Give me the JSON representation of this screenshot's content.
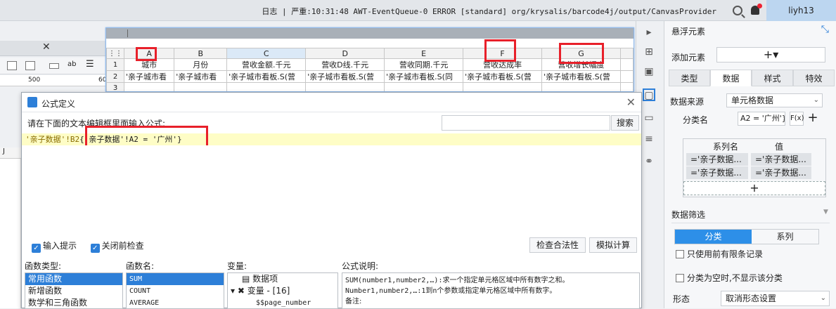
{
  "topbar": {
    "status_text": "日志 | 严重:10:31:48 AWT-EventQueue-0 ERROR [standard] org/krysalis/barcode4j/output/CanvasProvider",
    "user": "liyh13"
  },
  "left_area": {
    "ruler_marks": [
      "500",
      "60"
    ],
    "col_label": "J"
  },
  "sheet": {
    "columns": [
      "A",
      "B",
      "C",
      "D",
      "E",
      "F",
      "G"
    ],
    "row_numbers": [
      "1",
      "2",
      "3"
    ],
    "headers": [
      "城市",
      "月份",
      "营收金额.千元",
      "营收D线.千元",
      "营收同期.千元",
      "营收达成率",
      "营收增长幅度"
    ],
    "row2": [
      "'亲子城市看",
      "'亲子城市看",
      "'亲子城市看板.S(营",
      "'亲子城市看板.S(营",
      "'亲子城市看板.S(同",
      "'亲子城市看板.S(营",
      "'亲子城市看板.S(营"
    ]
  },
  "right_panel": {
    "title": "悬浮元素",
    "add_label": "添加元素",
    "add_button": "+▾",
    "tabs": [
      "类型",
      "数据",
      "样式",
      "特效"
    ],
    "active_tab": "数据",
    "data_source_label": "数据来源",
    "data_source_value": "单元格数据",
    "category_label": "分类名",
    "category_value": "A2 = '广州'}",
    "fx_label": "F(x)",
    "series_header": "系列名",
    "value_header": "值",
    "series_rows": [
      {
        "name": "='亲子数据...",
        "value": "='亲子数据..."
      },
      {
        "name": "='亲子数据...",
        "value": "='亲子数据..."
      }
    ],
    "filter_title": "数据筛选",
    "toggle_options": [
      "分类",
      "系列"
    ],
    "opt_limit": "只使用前有限条记录",
    "opt_hide_empty": "分类为空时,不显示该分类",
    "shape_label": "形态",
    "shape_value": "取消形态设置"
  },
  "dialog": {
    "title": "公式定义",
    "prompt": "请在下面的文本编辑框里面输入公式:",
    "search_button": "搜索",
    "formula_prefix": "'亲子数据'!B2",
    "formula_highlight": "{'亲子数据'!A2 = '广州'}",
    "tip_input": "输入提示",
    "tip_check": "关闭前检查",
    "check_button": "检查合法性",
    "simulate_button": "模拟计算",
    "func_type_header": "函数类型:",
    "func_name_header": "函数名:",
    "variable_header": "变量:",
    "desc_header": "公式说明:",
    "func_types": [
      "常用函数",
      "新增函数",
      "数学和三角函数"
    ],
    "func_names": [
      "SUM",
      "COUNT",
      "AVERAGE"
    ],
    "variables": [
      "数据项",
      "变量 - [16]",
      "$$page_number"
    ],
    "desc_lines": [
      "SUM(number1,number2,…):求一个指定单元格区域中所有数字之和。",
      "Number1,number2,…:1到n个参数或指定单元格区域中所有数字。",
      "备注:"
    ]
  }
}
